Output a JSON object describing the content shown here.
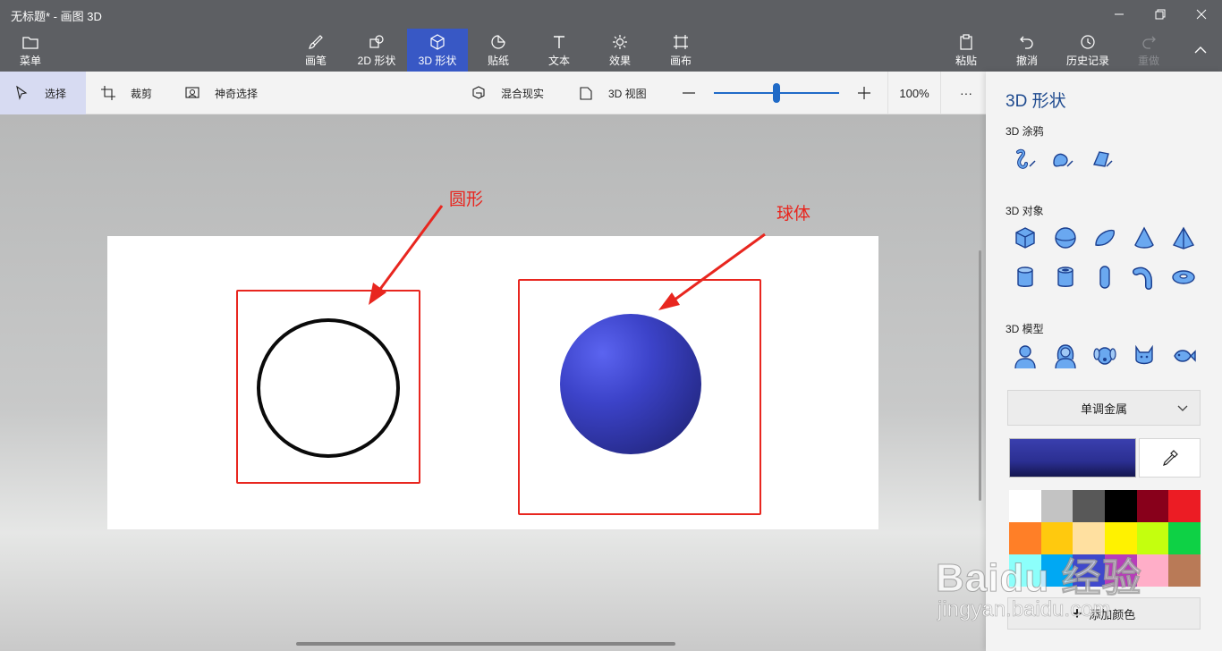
{
  "window": {
    "title": "无标题* - 画图 3D"
  },
  "ribbon": {
    "menu_label": "菜单",
    "tools": [
      "画笔",
      "2D 形状",
      "3D 形状",
      "贴纸",
      "文本",
      "效果",
      "画布"
    ],
    "active_tool": "3D 形状",
    "right": [
      "粘贴",
      "撤消",
      "历史记录",
      "重做"
    ]
  },
  "toolbar": {
    "select_label": "选择",
    "crop_label": "裁剪",
    "magic_select_label": "神奇选择",
    "mixed_reality_label": "混合现实",
    "view3d_label": "3D 视图",
    "zoom": "100%",
    "zoom_value": 0.5,
    "more_label": "···"
  },
  "annotations": {
    "circle_label": "圆形",
    "sphere_label": "球体"
  },
  "panel": {
    "title": "3D 形状",
    "doodle_section": "3D 涂鸦",
    "doodle_icons": [
      "sharp-edge-doodle-icon",
      "soft-edge-doodle-icon",
      "tube-doodle-icon"
    ],
    "objects_section": "3D 对象",
    "object_icons": [
      "cube-icon",
      "sphere-icon",
      "hemisphere-icon",
      "cone-icon",
      "pyramid-icon",
      "cylinder-icon",
      "tube-icon",
      "capsule-icon",
      "curved-tube-icon",
      "donut-icon"
    ],
    "models_section": "3D 模型",
    "model_icons": [
      "man-icon",
      "woman-icon",
      "dog-icon",
      "cat-icon",
      "fish-icon"
    ],
    "material": "单调金属",
    "current_color": "#2d3297",
    "palette": [
      "#ffffff",
      "#c3c3c3",
      "#585858",
      "#000000",
      "#88001b",
      "#ec1c24",
      "#ff7f27",
      "#ffc90e",
      "#ffe0a0",
      "#fff200",
      "#c4ff0e",
      "#0ed145",
      "#8cfffb",
      "#00a8f3",
      "#3f48cc",
      "#b83dba",
      "#ffaec8",
      "#b97a57"
    ],
    "add_color_label": "添加颜色"
  },
  "watermark": {
    "text": "Baidu 经验",
    "url": "jingyan.baidu.com"
  }
}
